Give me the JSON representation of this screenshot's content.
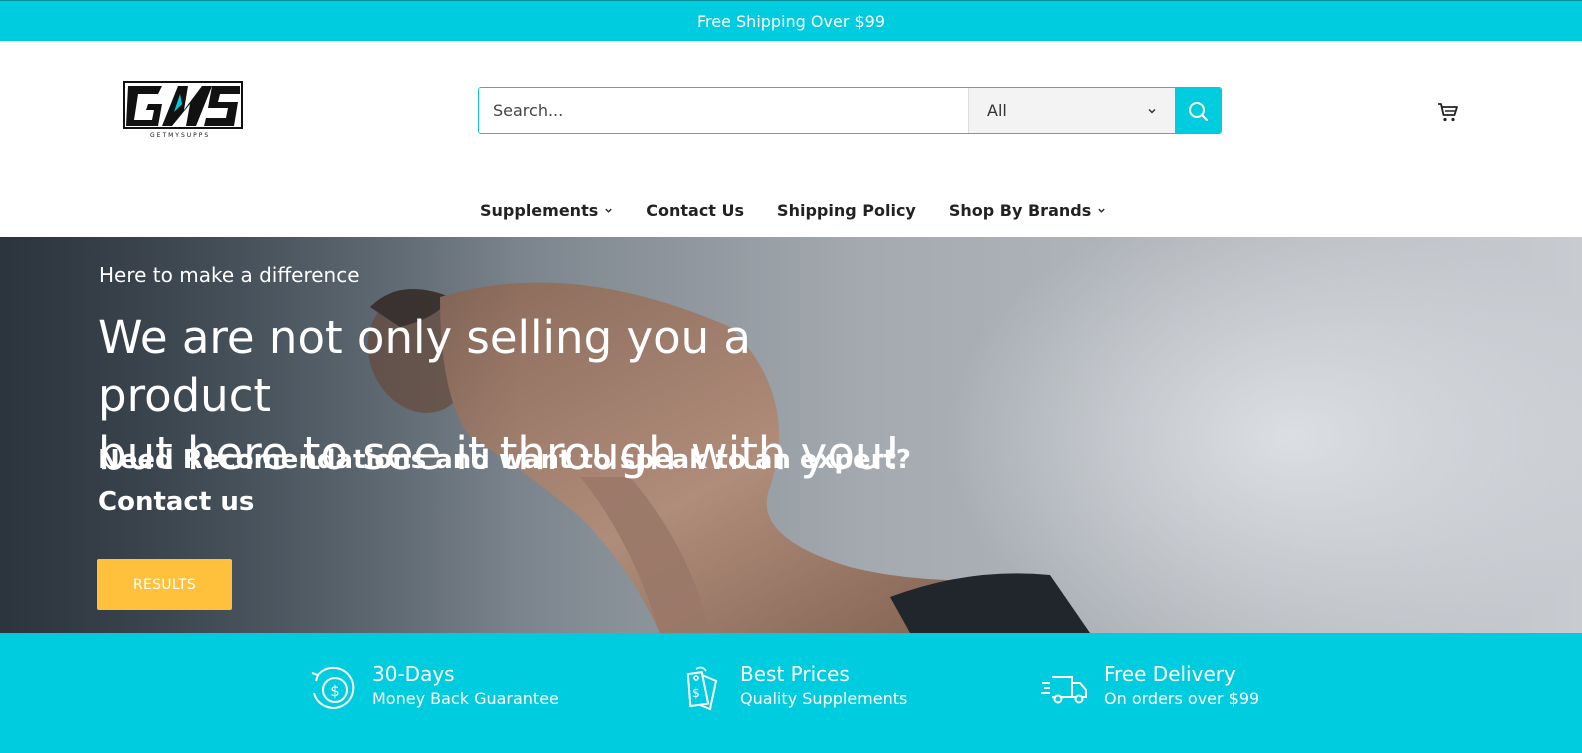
{
  "announcement": "Free Shipping Over $99",
  "search": {
    "placeholder": "Search...",
    "category": "All"
  },
  "nav": [
    {
      "label": "Supplements",
      "has_dropdown": true
    },
    {
      "label": "Contact Us",
      "has_dropdown": false
    },
    {
      "label": "Shipping Policy",
      "has_dropdown": false
    },
    {
      "label": "Shop By Brands",
      "has_dropdown": true
    }
  ],
  "hero": {
    "subtitle": "Here to make a difference",
    "title_line1": "We are not only selling you a product",
    "title_line2": "but here to see it through with you!",
    "cta_line1": "Need Recomendations and want to speak to an expert?",
    "cta_line2": "Contact us",
    "button": "RESULTS"
  },
  "features": [
    {
      "icon": "money-back-icon",
      "title": "30-Days",
      "subtitle": "Money Back Guarantee"
    },
    {
      "icon": "price-tag-icon",
      "title": "Best Prices",
      "subtitle": "Quality Supplements"
    },
    {
      "icon": "delivery-truck-icon",
      "title": "Free Delivery",
      "subtitle": "On orders over $99"
    }
  ],
  "colors": {
    "accent": "#00cce0",
    "button": "#ffc13b"
  }
}
